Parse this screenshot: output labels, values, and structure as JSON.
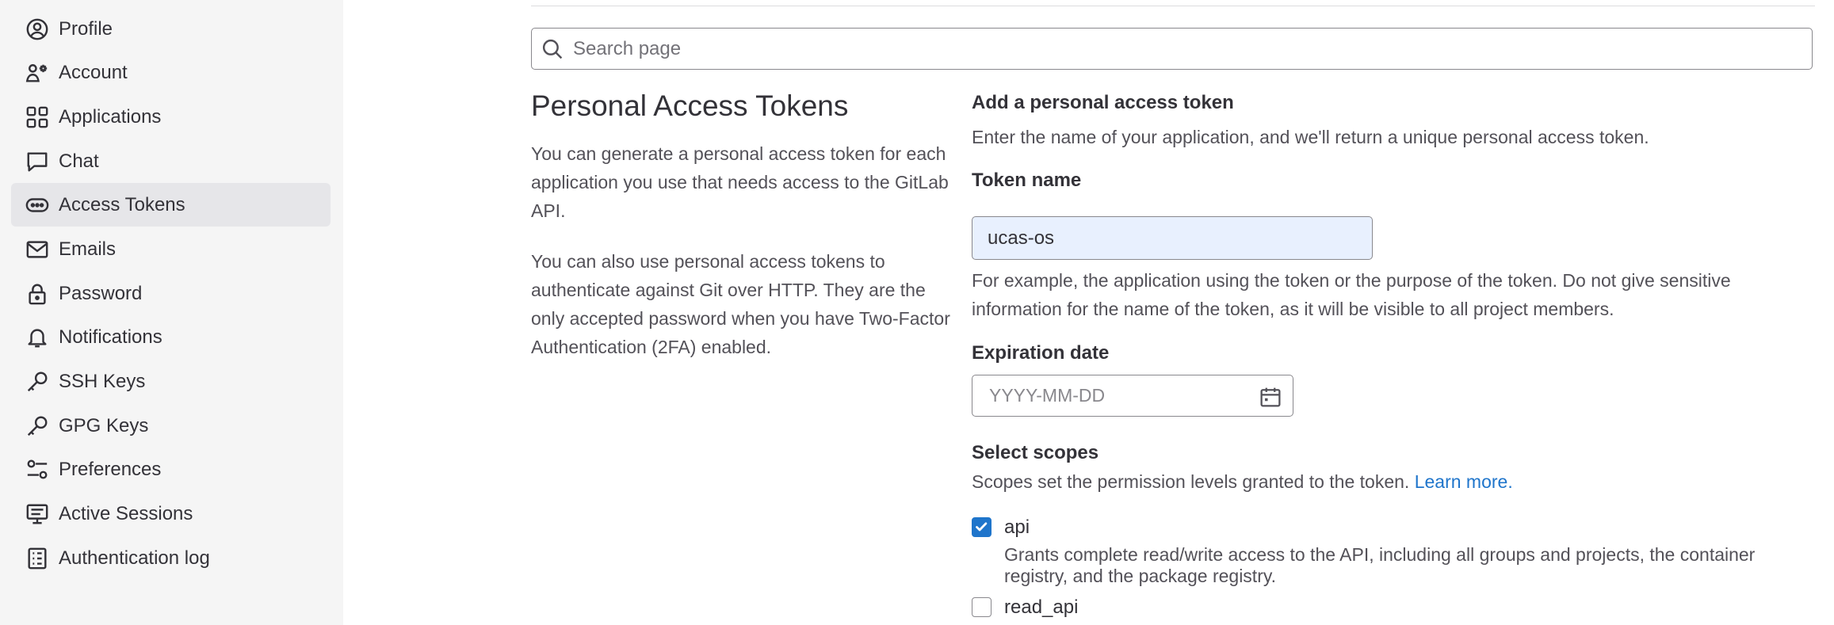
{
  "sidebar": {
    "items": [
      {
        "label": "Profile",
        "icon": "profile-icon"
      },
      {
        "label": "Account",
        "icon": "account-icon"
      },
      {
        "label": "Applications",
        "icon": "applications-icon"
      },
      {
        "label": "Chat",
        "icon": "chat-icon"
      },
      {
        "label": "Access Tokens",
        "icon": "token-icon",
        "active": true
      },
      {
        "label": "Emails",
        "icon": "mail-icon"
      },
      {
        "label": "Password",
        "icon": "lock-icon"
      },
      {
        "label": "Notifications",
        "icon": "bell-icon"
      },
      {
        "label": "SSH Keys",
        "icon": "key-icon"
      },
      {
        "label": "GPG Keys",
        "icon": "key-icon"
      },
      {
        "label": "Preferences",
        "icon": "preferences-icon"
      },
      {
        "label": "Active Sessions",
        "icon": "monitor-icon"
      },
      {
        "label": "Authentication log",
        "icon": "log-icon"
      }
    ]
  },
  "search": {
    "placeholder": "Search page"
  },
  "intro": {
    "title": "Personal Access Tokens",
    "paragraph1": "You can generate a personal access token for each application you use that needs access to the GitLab API.",
    "paragraph2": "You can also use personal access tokens to authenticate against Git over HTTP. They are the only accepted password when you have Two-Factor Authentication (2FA) enabled."
  },
  "form": {
    "heading": "Add a personal access token",
    "subheading": "Enter the name of your application, and we'll return a unique personal access token.",
    "token_name_label": "Token name",
    "token_name_value": "ucas-os",
    "token_name_help": "For example, the application using the token or the purpose of the token. Do not give sensitive information for the name of the token, as it will be visible to all project members.",
    "expiration_label": "Expiration date",
    "expiration_placeholder": "YYYY-MM-DD",
    "scopes_label": "Select scopes",
    "scopes_help": "Scopes set the permission levels granted to the token.",
    "scopes_link": "Learn more.",
    "scopes": [
      {
        "name": "api",
        "checked": true,
        "description": "Grants complete read/write access to the API, including all groups and projects, the container registry, and the package registry."
      },
      {
        "name": "read_api",
        "checked": false,
        "description": ""
      }
    ]
  },
  "colors": {
    "accent": "#1f75cb",
    "sidebar_bg": "#f5f5f5",
    "active_item_bg": "#e6e6e9"
  }
}
